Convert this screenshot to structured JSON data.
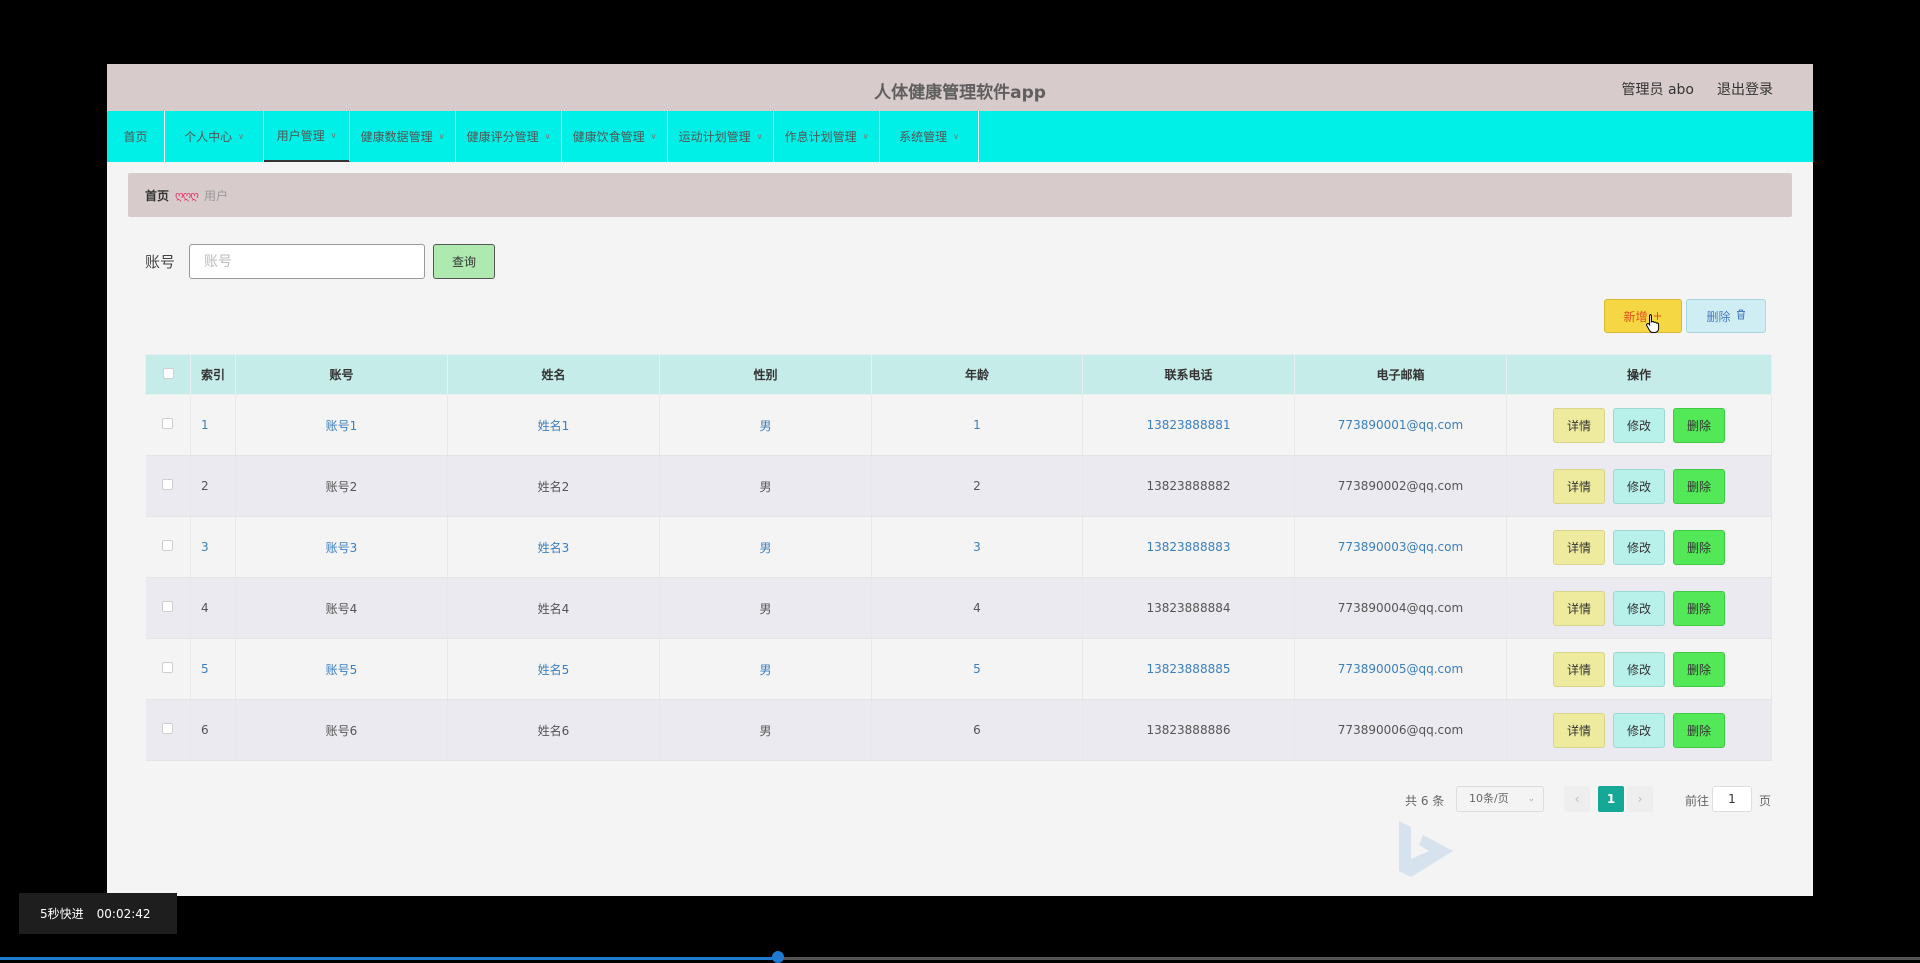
{
  "app": {
    "title": "人体健康管理软件app",
    "admin_label": "管理员 abo",
    "logout_label": "退出登录"
  },
  "nav": {
    "items": [
      {
        "label": "首页",
        "has_dropdown": false,
        "active": false
      },
      {
        "label": "个人中心",
        "has_dropdown": true,
        "active": false
      },
      {
        "label": "用户管理",
        "has_dropdown": true,
        "active": true
      },
      {
        "label": "健康数据管理",
        "has_dropdown": true,
        "active": false
      },
      {
        "label": "健康评分管理",
        "has_dropdown": true,
        "active": false
      },
      {
        "label": "健康饮食管理",
        "has_dropdown": true,
        "active": false
      },
      {
        "label": "运动计划管理",
        "has_dropdown": true,
        "active": false
      },
      {
        "label": "作息计划管理",
        "has_dropdown": true,
        "active": false
      },
      {
        "label": "系统管理",
        "has_dropdown": true,
        "active": false
      }
    ]
  },
  "breadcrumb": {
    "home": "首页",
    "separator": "ღღღ",
    "current": "用户"
  },
  "search": {
    "label": "账号",
    "placeholder": "账号",
    "value": "",
    "button_label": "查询"
  },
  "toolbar": {
    "add_label": "新增",
    "add_icon": "plus-icon",
    "delete_label": "删除",
    "delete_icon": "trash-icon"
  },
  "table": {
    "columns": [
      "索引",
      "账号",
      "姓名",
      "性别",
      "年龄",
      "联系电话",
      "电子邮箱",
      "操作"
    ],
    "rows": [
      {
        "index": "1",
        "account": "账号1",
        "name": "姓名1",
        "gender": "男",
        "age": "1",
        "phone": "13823888881",
        "email": "773890001@qq.com"
      },
      {
        "index": "2",
        "account": "账号2",
        "name": "姓名2",
        "gender": "男",
        "age": "2",
        "phone": "13823888882",
        "email": "773890002@qq.com"
      },
      {
        "index": "3",
        "account": "账号3",
        "name": "姓名3",
        "gender": "男",
        "age": "3",
        "phone": "13823888883",
        "email": "773890003@qq.com"
      },
      {
        "index": "4",
        "account": "账号4",
        "name": "姓名4",
        "gender": "男",
        "age": "4",
        "phone": "13823888884",
        "email": "773890004@qq.com"
      },
      {
        "index": "5",
        "account": "账号5",
        "name": "姓名5",
        "gender": "男",
        "age": "5",
        "phone": "13823888885",
        "email": "773890005@qq.com"
      },
      {
        "index": "6",
        "account": "账号6",
        "name": "姓名6",
        "gender": "男",
        "age": "6",
        "phone": "13823888886",
        "email": "773890006@qq.com"
      }
    ],
    "row_actions": {
      "detail": "详情",
      "edit": "修改",
      "delete": "删除"
    }
  },
  "pagination": {
    "total_text": "共 6 条",
    "page_size": "10条/页",
    "current_page": "1",
    "goto_label": "前往",
    "goto_value": "1",
    "page_unit": "页"
  },
  "player": {
    "speed_label": "5秒快进",
    "time": "00:02:42",
    "progress_fraction": 0.405
  },
  "colors": {
    "topbar": "#d7cbcb",
    "navbar": "#00efe6",
    "table_header": "#c6ece9",
    "link_blue": "#3c7fbd",
    "add_button": "#f4d743",
    "delete_button": "#52e857",
    "pagination_active": "#16a896",
    "progress": "#1f7ad1"
  }
}
